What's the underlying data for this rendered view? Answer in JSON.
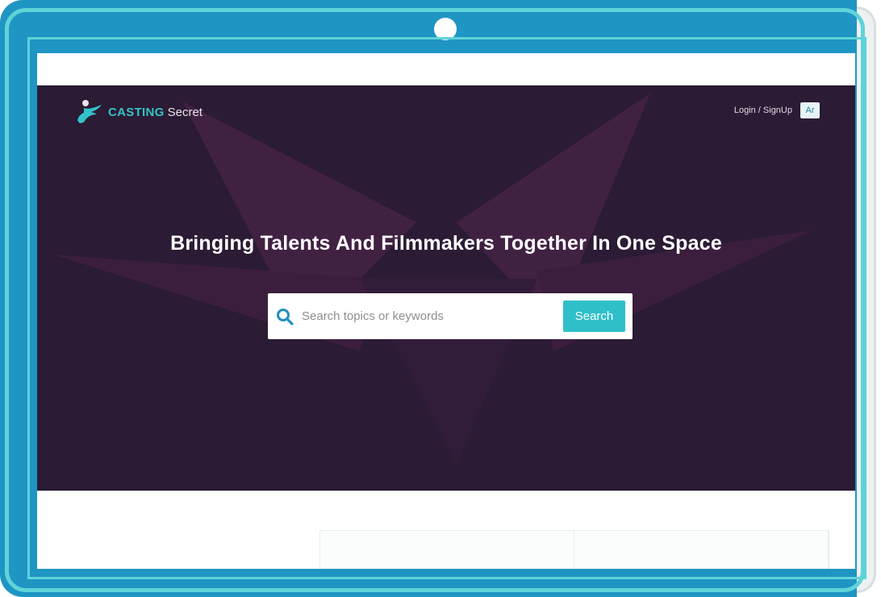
{
  "brand": {
    "name_primary": "CASTING",
    "name_secondary": "Secret"
  },
  "nav": {
    "login_label": "Login / SignUp",
    "language_label": "Ar"
  },
  "hero": {
    "headline": "Bringing Talents And Filmmakers Together In One Space"
  },
  "search": {
    "placeholder": "Search topics or keywords",
    "button_label": "Search"
  },
  "icons": {
    "logo": "casting-secret-logo-icon",
    "search": "search-icon"
  },
  "colors": {
    "frame": "#1f95c4",
    "frame_outline": "#5fd3d8",
    "hero_bg": "#2b1b34",
    "accent": "#2fbfc8"
  }
}
